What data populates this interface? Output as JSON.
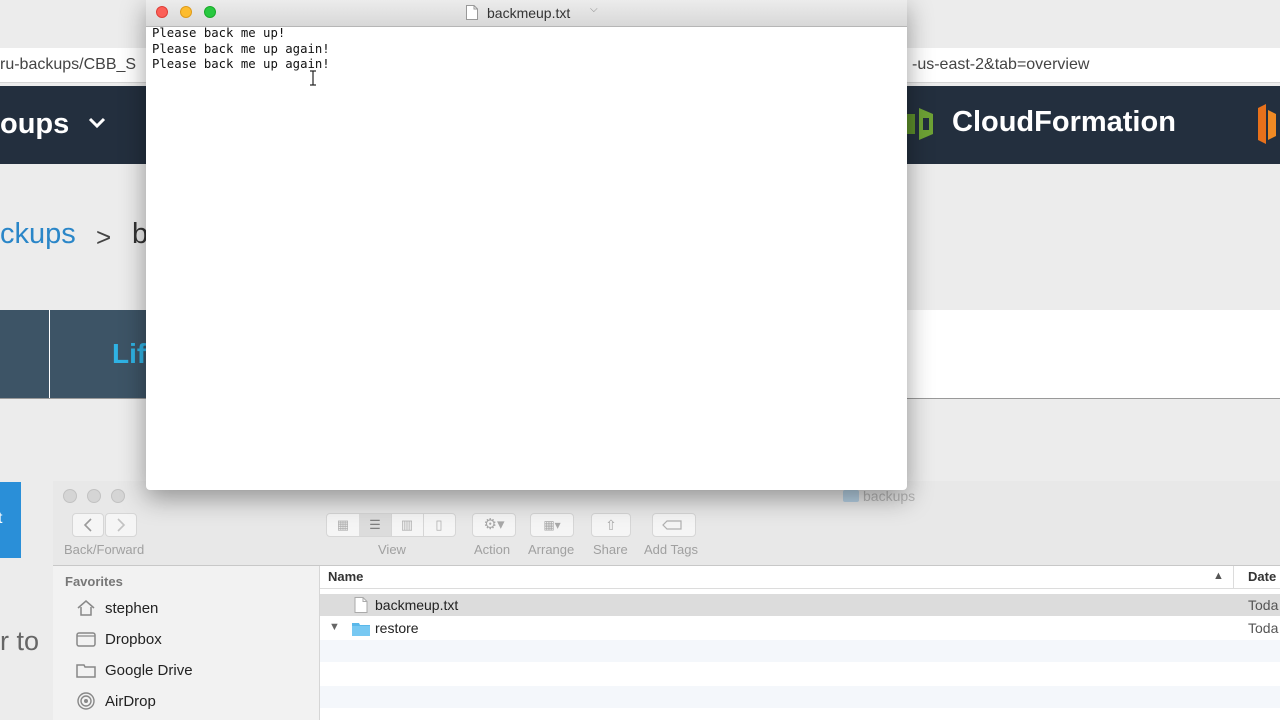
{
  "background_browser": {
    "url_left": "ru-backups/CBB_S",
    "url_right": "-us-east-2&tab=overview",
    "bucket_label": "oups",
    "service_label": "CloudFormation",
    "breadcrumb_link": "ckups",
    "breadcrumb_sep": ">",
    "breadcrumb_next": "b",
    "tab_label": "Lif",
    "ghost_text": "r to",
    "blue_button_text": "t"
  },
  "textedit": {
    "title": "backmeup.txt",
    "lines": [
      "Please back me up!",
      "Please back me up again!",
      "Please back me up again!"
    ]
  },
  "finder": {
    "title": "backups",
    "toolbar": {
      "back_forward_label": "Back/Forward",
      "view_label": "View",
      "action_label": "Action",
      "arrange_label": "Arrange",
      "share_label": "Share",
      "tags_label": "Add Tags"
    },
    "sidebar": {
      "heading": "Favorites",
      "items": [
        {
          "label": "stephen",
          "icon": "home-icon"
        },
        {
          "label": "Dropbox",
          "icon": "dropbox-icon"
        },
        {
          "label": "Google Drive",
          "icon": "folder-icon"
        },
        {
          "label": "AirDrop",
          "icon": "airdrop-icon"
        }
      ]
    },
    "columns": {
      "name": "Name",
      "date": "Date"
    },
    "rows": [
      {
        "name": "backmeup.txt",
        "date": "Toda",
        "kind": "file"
      },
      {
        "name": "restore",
        "date": "Toda",
        "kind": "folder"
      }
    ]
  },
  "colors": {
    "aws_nav": "#232f3e",
    "link_blue": "#2a86c8",
    "close": "#fc5f57",
    "minimize": "#fdbc2e",
    "zoom": "#28c840"
  }
}
